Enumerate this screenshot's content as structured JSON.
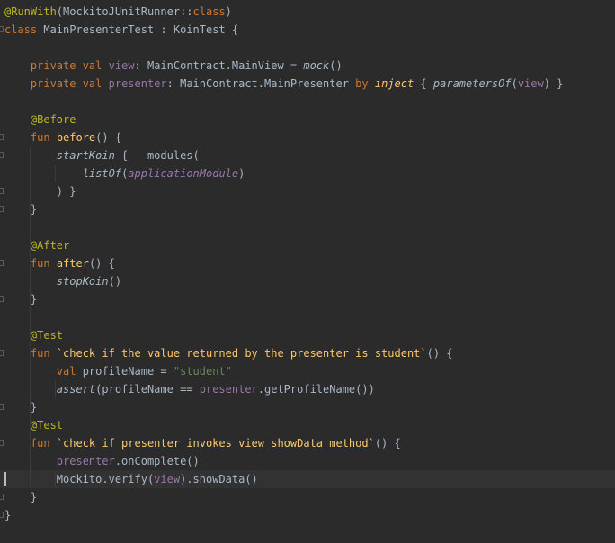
{
  "editor": {
    "lines": [
      [
        {
          "t": "@RunWith",
          "c": "ann"
        },
        {
          "t": "(MockitoJUnitRunner::",
          "c": "plain"
        },
        {
          "t": "class",
          "c": "kw"
        },
        {
          "t": ")",
          "c": "plain"
        }
      ],
      [
        {
          "t": "class ",
          "c": "kw"
        },
        {
          "t": "MainPresenterTest : KoinTest {",
          "c": "plain"
        }
      ],
      [],
      [
        {
          "t": "    ",
          "c": "plain"
        },
        {
          "t": "private val ",
          "c": "kw"
        },
        {
          "t": "view",
          "c": "prop"
        },
        {
          "t": ": MainContract.MainView = ",
          "c": "plain"
        },
        {
          "t": "mock",
          "c": "plain ital"
        },
        {
          "t": "()",
          "c": "plain"
        }
      ],
      [
        {
          "t": "    ",
          "c": "plain"
        },
        {
          "t": "private val ",
          "c": "kw"
        },
        {
          "t": "presenter",
          "c": "prop"
        },
        {
          "t": ": MainContract.MainPresenter ",
          "c": "plain"
        },
        {
          "t": "by ",
          "c": "kw"
        },
        {
          "t": "inject",
          "c": "fn ital"
        },
        {
          "t": " { ",
          "c": "plain"
        },
        {
          "t": "parametersOf",
          "c": "plain ital"
        },
        {
          "t": "(",
          "c": "plain"
        },
        {
          "t": "view",
          "c": "prop"
        },
        {
          "t": ") }",
          "c": "plain"
        }
      ],
      [],
      [
        {
          "t": "    ",
          "c": "plain"
        },
        {
          "t": "@Before",
          "c": "ann"
        }
      ],
      [
        {
          "t": "    ",
          "c": "plain"
        },
        {
          "t": "fun ",
          "c": "kw"
        },
        {
          "t": "before",
          "c": "fn"
        },
        {
          "t": "() {",
          "c": "plain"
        }
      ],
      [
        {
          "t": "        ",
          "c": "plain"
        },
        {
          "t": "startKoin",
          "c": "plain ital"
        },
        {
          "t": " {   modules(",
          "c": "plain"
        }
      ],
      [
        {
          "t": "            ",
          "c": "plain"
        },
        {
          "t": "listOf",
          "c": "plain ital"
        },
        {
          "t": "(",
          "c": "plain"
        },
        {
          "t": "applicationModule",
          "c": "prop ital"
        },
        {
          "t": ")",
          "c": "plain"
        }
      ],
      [
        {
          "t": "        ) }",
          "c": "plain"
        }
      ],
      [
        {
          "t": "    }",
          "c": "plain"
        }
      ],
      [],
      [
        {
          "t": "    ",
          "c": "plain"
        },
        {
          "t": "@After",
          "c": "ann"
        }
      ],
      [
        {
          "t": "    ",
          "c": "plain"
        },
        {
          "t": "fun ",
          "c": "kw"
        },
        {
          "t": "after",
          "c": "fn"
        },
        {
          "t": "() {",
          "c": "plain"
        }
      ],
      [
        {
          "t": "        ",
          "c": "plain"
        },
        {
          "t": "stopKoin",
          "c": "plain ital"
        },
        {
          "t": "()",
          "c": "plain"
        }
      ],
      [
        {
          "t": "    }",
          "c": "plain"
        }
      ],
      [],
      [
        {
          "t": "    ",
          "c": "plain"
        },
        {
          "t": "@Test",
          "c": "ann"
        }
      ],
      [
        {
          "t": "    ",
          "c": "plain"
        },
        {
          "t": "fun ",
          "c": "kw"
        },
        {
          "t": "`check if the value returned by the presenter is student`",
          "c": "fn"
        },
        {
          "t": "() {",
          "c": "plain"
        }
      ],
      [
        {
          "t": "        ",
          "c": "plain"
        },
        {
          "t": "val ",
          "c": "kw"
        },
        {
          "t": "profileName = ",
          "c": "plain"
        },
        {
          "t": "\"student\"",
          "c": "str"
        }
      ],
      [
        {
          "t": "        ",
          "c": "plain"
        },
        {
          "t": "assert",
          "c": "plain ital"
        },
        {
          "t": "(profileName == ",
          "c": "plain"
        },
        {
          "t": "presenter",
          "c": "prop"
        },
        {
          "t": ".getProfileName())",
          "c": "plain"
        }
      ],
      [
        {
          "t": "    }",
          "c": "plain"
        }
      ],
      [
        {
          "t": "    ",
          "c": "plain"
        },
        {
          "t": "@Test",
          "c": "ann"
        }
      ],
      [
        {
          "t": "    ",
          "c": "plain"
        },
        {
          "t": "fun ",
          "c": "kw"
        },
        {
          "t": "`check if presenter invokes view showData method`",
          "c": "fn"
        },
        {
          "t": "() {",
          "c": "plain"
        }
      ],
      [
        {
          "t": "        ",
          "c": "plain"
        },
        {
          "t": "presenter",
          "c": "prop"
        },
        {
          "t": ".onComplete()",
          "c": "plain"
        }
      ],
      [
        {
          "t": "        Mockito.verify(",
          "c": "plain"
        },
        {
          "t": "view",
          "c": "prop"
        },
        {
          "t": ").showData()",
          "c": "plain"
        }
      ],
      [
        {
          "t": "    }",
          "c": "plain"
        }
      ],
      [
        {
          "t": "}",
          "c": "plain"
        }
      ]
    ],
    "current_line_index": 26
  }
}
